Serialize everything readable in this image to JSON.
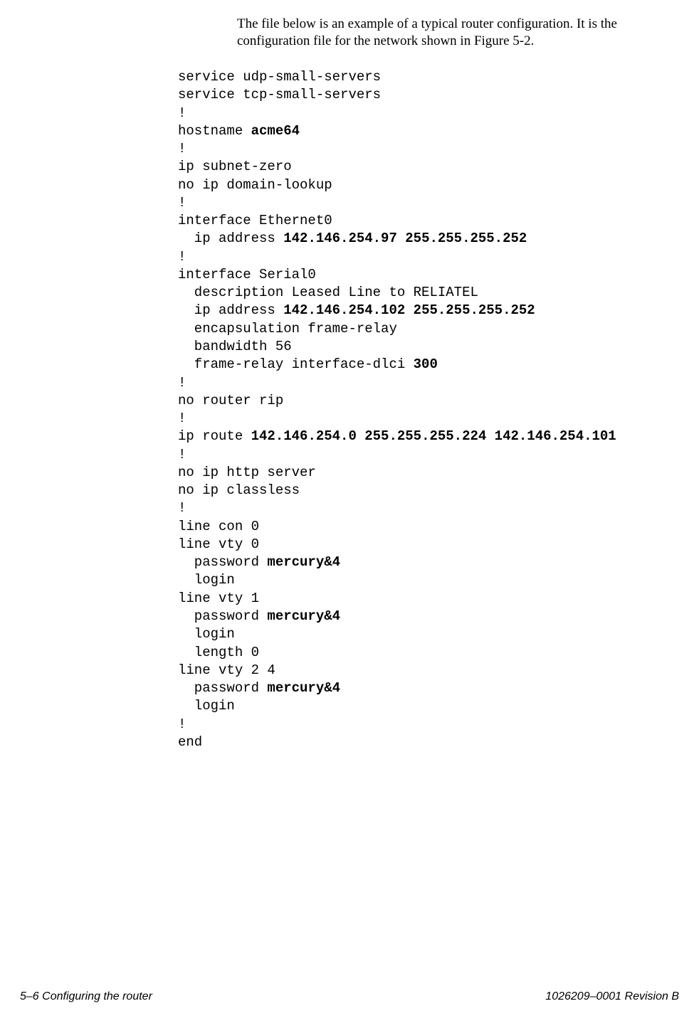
{
  "intro": "The file below is an example of a typical router configuration. It is the configuration file for the network shown in Figure 5-2.",
  "config": {
    "l1": "service udp-small-servers",
    "l2": "service tcp-small-servers",
    "l3": "!",
    "l4a": "hostname ",
    "l4b": "acme64",
    "l5": "!",
    "l6": "ip subnet-zero",
    "l7": "no ip domain-lookup",
    "l8": "!",
    "l9": "interface Ethernet0",
    "l10a": "  ip address ",
    "l10b": "142.146.254.97 255.255.255.252",
    "l11": "!",
    "l12": "interface Serial0",
    "l13": "  description Leased Line to RELIATEL",
    "l14a": "  ip address ",
    "l14b": "142.146.254.102 255.255.255.252",
    "l15": "  encapsulation frame-relay",
    "l16": "  bandwidth 56",
    "l17a": "  frame-relay interface-dlci ",
    "l17b": "300",
    "l18": "!",
    "l19": "no router rip",
    "l20": "!",
    "l21a": "ip route ",
    "l21b": "142.146.254.0 255.255.255.224 142.146.254.101",
    "l22": "!",
    "l23": "no ip http server",
    "l24": "no ip classless",
    "l25": "!",
    "l26": "line con 0",
    "l27": "line vty 0",
    "l28a": "  password ",
    "l28b": "mercury&4",
    "l29": "  login",
    "l30": "line vty 1",
    "l31a": "  password ",
    "l31b": "mercury&4",
    "l32": "  login",
    "l33": "  length 0",
    "l34": "line vty 2 4",
    "l35a": "  password ",
    "l35b": "mercury&4",
    "l36": "  login",
    "l37": "!",
    "l38": "end"
  },
  "footer": {
    "left": "5–6  Configuring the router",
    "right": "1026209–0001  Revision B"
  }
}
